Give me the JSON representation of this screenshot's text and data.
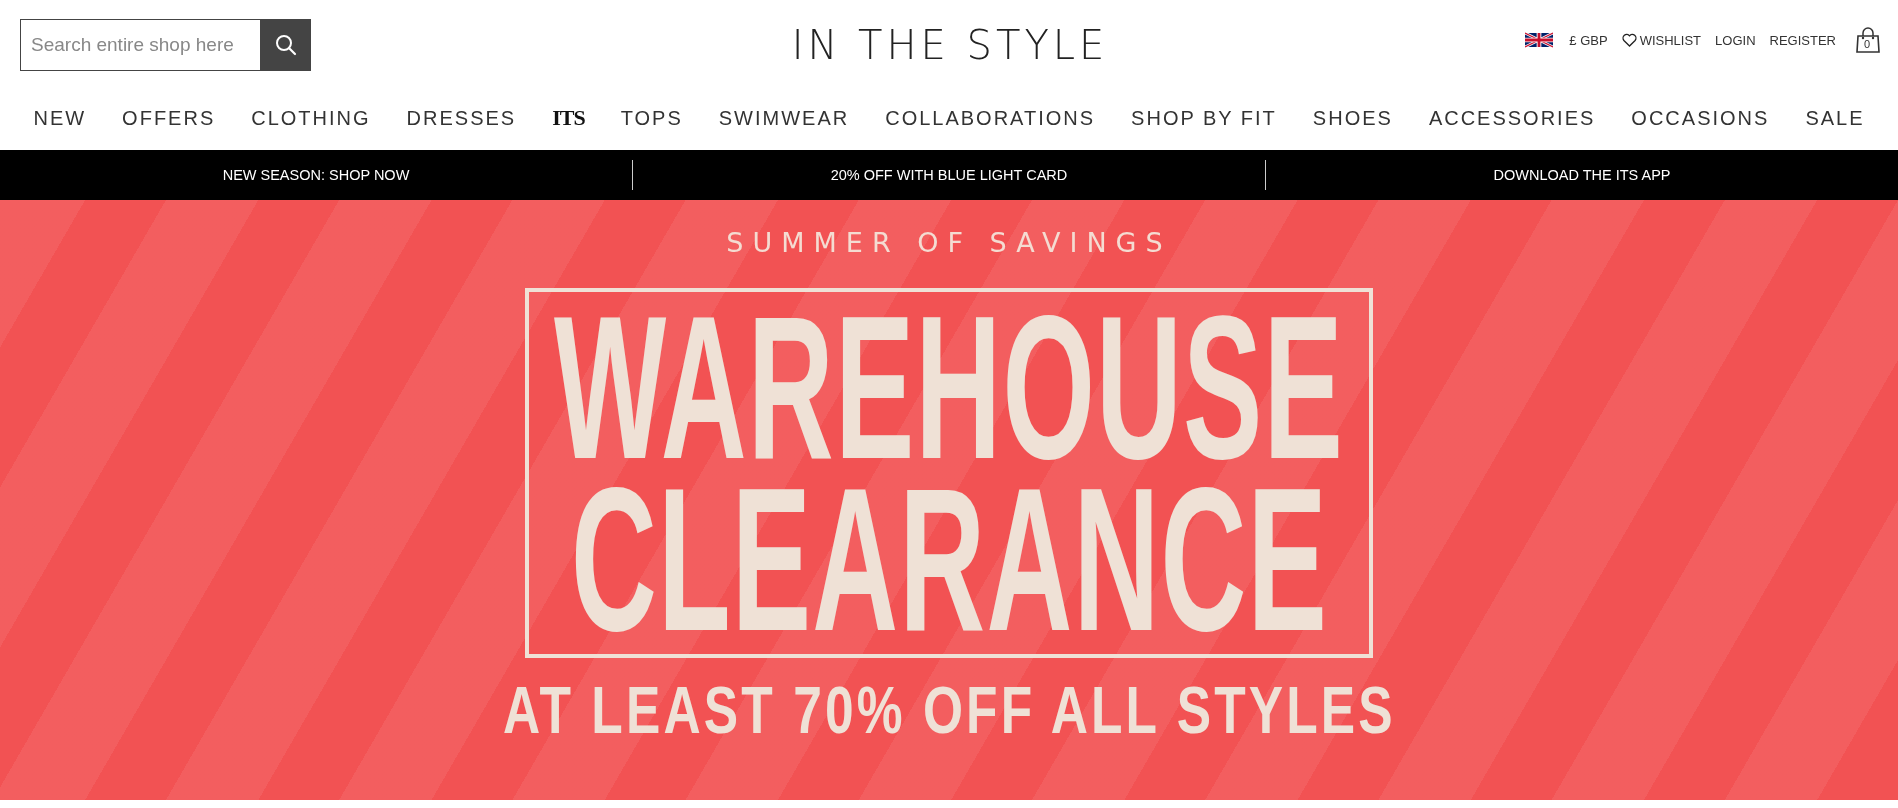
{
  "search": {
    "placeholder": "Search entire shop here"
  },
  "logo": "IN THE STYLE",
  "account": {
    "currency": "£ GBP",
    "links": [
      "WISHLIST",
      "LOGIN",
      "REGISTER"
    ],
    "cart_count": "0"
  },
  "nav": [
    {
      "label": "NEW",
      "kind": "text"
    },
    {
      "label": "OFFERS",
      "kind": "text"
    },
    {
      "label": "CLOTHING",
      "kind": "text"
    },
    {
      "label": "DRESSES",
      "kind": "text"
    },
    {
      "label": "ITS",
      "kind": "logo"
    },
    {
      "label": "TOPS",
      "kind": "text"
    },
    {
      "label": "SWIMWEAR",
      "kind": "text"
    },
    {
      "label": "COLLABORATIONS",
      "kind": "text"
    },
    {
      "label": "SHOP BY FIT",
      "kind": "text"
    },
    {
      "label": "SHOES",
      "kind": "text"
    },
    {
      "label": "ACCESSORIES",
      "kind": "text"
    },
    {
      "label": "OCCASIONS",
      "kind": "text"
    },
    {
      "label": "SALE",
      "kind": "text"
    }
  ],
  "promo_bar": [
    "NEW SEASON: SHOP NOW",
    "20% OFF WITH BLUE LIGHT CARD",
    "DOWNLOAD THE ITS APP"
  ],
  "hero": {
    "kicker": "SUMMER OF SAVINGS",
    "title_lines": [
      "WAREHOUSE",
      "CLEARANCE"
    ],
    "subtitle": "AT LEAST 70% OFF ALL STYLES"
  }
}
